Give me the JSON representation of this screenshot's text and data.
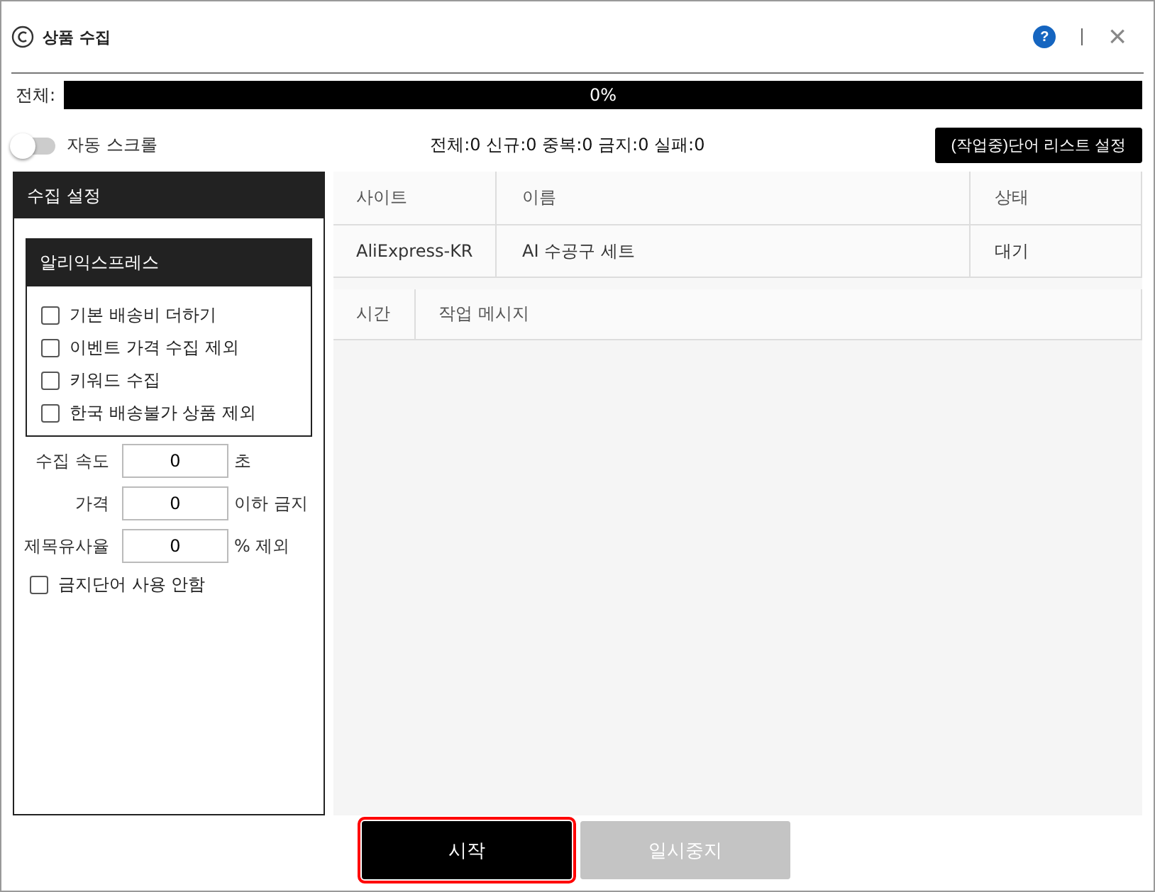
{
  "window": {
    "title": "상품 수집",
    "help": "?",
    "close": "×"
  },
  "progress": {
    "label": "전체:",
    "level": 0,
    "text": "0%"
  },
  "auto_scroll": {
    "label": "자동 스크롤",
    "on": false
  },
  "counts": "전체:0 신규:0 중복:0 금지:0 실패:0",
  "word_list_button": "(작업중)단어 리스트 설정",
  "settings": {
    "title": "수집 설정",
    "site_title": "알리익스프레스",
    "options": [
      {
        "label": "기본 배송비 더하기",
        "checked": false
      },
      {
        "label": "이벤트 가격 수집 제외",
        "checked": false
      },
      {
        "label": "키워드 수집",
        "checked": false
      },
      {
        "label": "한국 배송불가 상품 제외",
        "checked": false
      }
    ],
    "fields": [
      {
        "label": "수집 속도",
        "value": "0",
        "unit": "초"
      },
      {
        "label": "가격",
        "value": "0",
        "unit": "이하 금지"
      },
      {
        "label": "제목유사율",
        "value": "0",
        "unit": "% 제외"
      }
    ],
    "no_banned": {
      "label": "금지단어 사용 안함",
      "checked": false
    }
  },
  "table": {
    "columns": [
      "사이트",
      "이름",
      "상태"
    ],
    "rows": [
      [
        "AliExpress-KR",
        "AI 수공구 세트",
        "대기"
      ]
    ]
  },
  "log": {
    "columns": [
      "시간",
      "작업 메시지"
    ]
  },
  "buttons": [
    {
      "label": "시작",
      "disabled": false,
      "highlighted": true
    },
    {
      "label": "일시중지",
      "disabled": true,
      "highlighted": false
    }
  ]
}
